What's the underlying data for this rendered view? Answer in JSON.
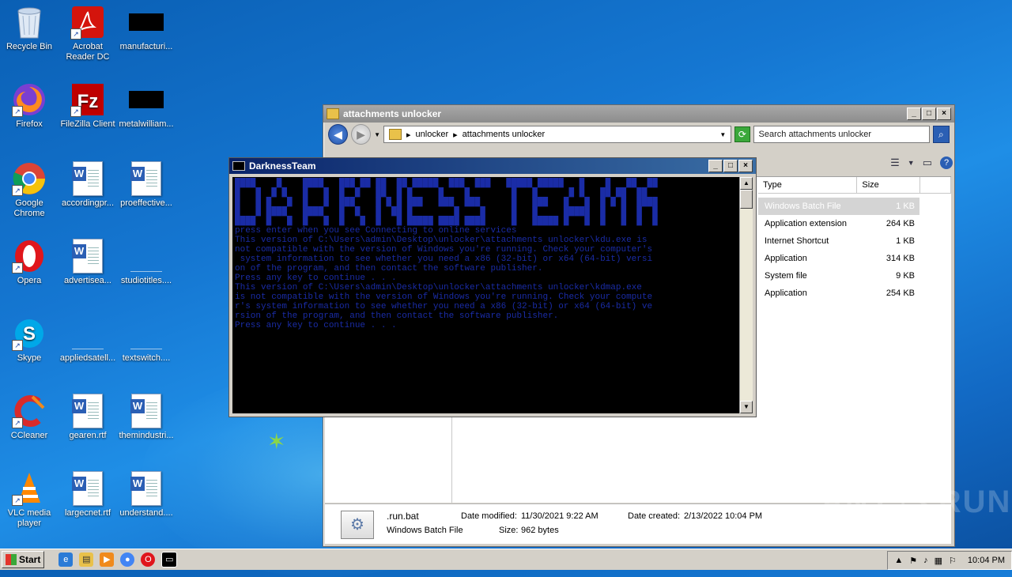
{
  "desktop": {
    "icons": [
      {
        "label": "Recycle Bin",
        "icon": "recycle-bin-icon"
      },
      {
        "label": "Acrobat Reader DC",
        "label_line1": "Acrobat",
        "label_line2": "Reader DC",
        "icon": "acrobat-icon"
      },
      {
        "label": "manufacturi...",
        "icon": "black-file-icon"
      },
      {
        "label": "Firefox",
        "icon": "firefox-icon"
      },
      {
        "label": "FileZilla Client",
        "icon": "filezilla-icon"
      },
      {
        "label": "metalwilliam...",
        "icon": "black-file-icon"
      },
      {
        "label": "Google Chrome",
        "label_line1": "Google",
        "label_line2": "Chrome",
        "icon": "chrome-icon"
      },
      {
        "label": "accordingpr...",
        "icon": "word-doc-icon"
      },
      {
        "label": "proeffective...",
        "icon": "word-doc-icon"
      },
      {
        "label": "Opera",
        "icon": "opera-icon"
      },
      {
        "label": "advertisea...",
        "icon": "word-doc-icon"
      },
      {
        "label": "studiotitles....",
        "icon": "blank-file-icon"
      },
      {
        "label": "Skype",
        "icon": "skype-icon"
      },
      {
        "label": "appliedsatell...",
        "icon": "blank-file-icon"
      },
      {
        "label": "textswitch....",
        "icon": "blank-file-icon"
      },
      {
        "label": "CCleaner",
        "icon": "ccleaner-icon"
      },
      {
        "label": "gearen.rtf",
        "icon": "word-doc-icon"
      },
      {
        "label": "themindustri...",
        "icon": "word-doc-icon"
      },
      {
        "label": "VLC media player",
        "label_line1": "VLC media",
        "label_line2": "player",
        "icon": "vlc-icon"
      },
      {
        "label": "largecnet.rtf",
        "icon": "word-doc-icon"
      },
      {
        "label": "understand....",
        "icon": "word-doc-icon"
      }
    ]
  },
  "explorer": {
    "title": "attachments unlocker",
    "breadcrumb": [
      "unlocker",
      "attachments unlocker"
    ],
    "search_placeholder": "Search attachments unlocker",
    "columns": {
      "type": "Type",
      "size": "Size"
    },
    "files": [
      {
        "type": "Windows Batch File",
        "size": "1 KB",
        "selected": true
      },
      {
        "type": "Application extension",
        "size": "264 KB"
      },
      {
        "type": "Internet Shortcut",
        "size": "1 KB"
      },
      {
        "type": "Application",
        "size": "314 KB"
      },
      {
        "type": "System file",
        "size": "9 KB"
      },
      {
        "type": "Application",
        "size": "254 KB"
      }
    ],
    "details": {
      "name": ".run.bat",
      "file_type": "Windows Batch File",
      "modified_label": "Date modified:",
      "modified_value": "11/30/2021 9:22 AM",
      "size_label": "Size:",
      "size_value": "962 bytes",
      "created_label": "Date created:",
      "created_value": "2/13/2022 10:04 PM"
    }
  },
  "console": {
    "title": "DarknessTeam",
    "text": "████    █    ████   ███ ██ ██  ██ █████  ███  ███   █████ █████   █    █   ██  ██\n█   █  █ █   █   █  █  █   ██  █ █     █    █        █   █      █ █   ██ ██  ██\n█   █ █   █  █   █  ███    █ █ █ ███   ███  ███      █   ███   █   █  █ █ █  ████\n█   █ ████   ████   █  █   █  ██ █        █    █     █   █     █████  █   █  █  █\n████  █   █  █   █  █   █  █   █ █████ ████ ████     █   █████ █   █  █   █  █  █\npress enter when you see Connecting to online services\nThis version of C:\\Users\\admin\\Desktop\\unlocker\\attachments unlocker\\kdu.exe is\nnot compatible with the version of Windows you're running. Check your computer's\n system information to see whether you need a x86 (32-bit) or x64 (64-bit) versi\non of the program, and then contact the software publisher.\nPress any key to continue . . .\nThis version of C:\\Users\\admin\\Desktop\\unlocker\\attachments unlocker\\kdmap.exe\nis not compatible with the version of Windows you're running. Check your compute\nr's system information to see whether you need a x86 (32-bit) or x64 (64-bit) ve\nrsion of the program, and then contact the software publisher.\nPress any key to continue . . ."
  },
  "watermark": "ANY ▷ RUN",
  "taskbar": {
    "start_label": "Start",
    "clock": "10:04 PM"
  },
  "colors": {
    "console_text": "#1a2ca6",
    "desktop_bg": "#1577d2",
    "console_title": "#0a246a"
  }
}
